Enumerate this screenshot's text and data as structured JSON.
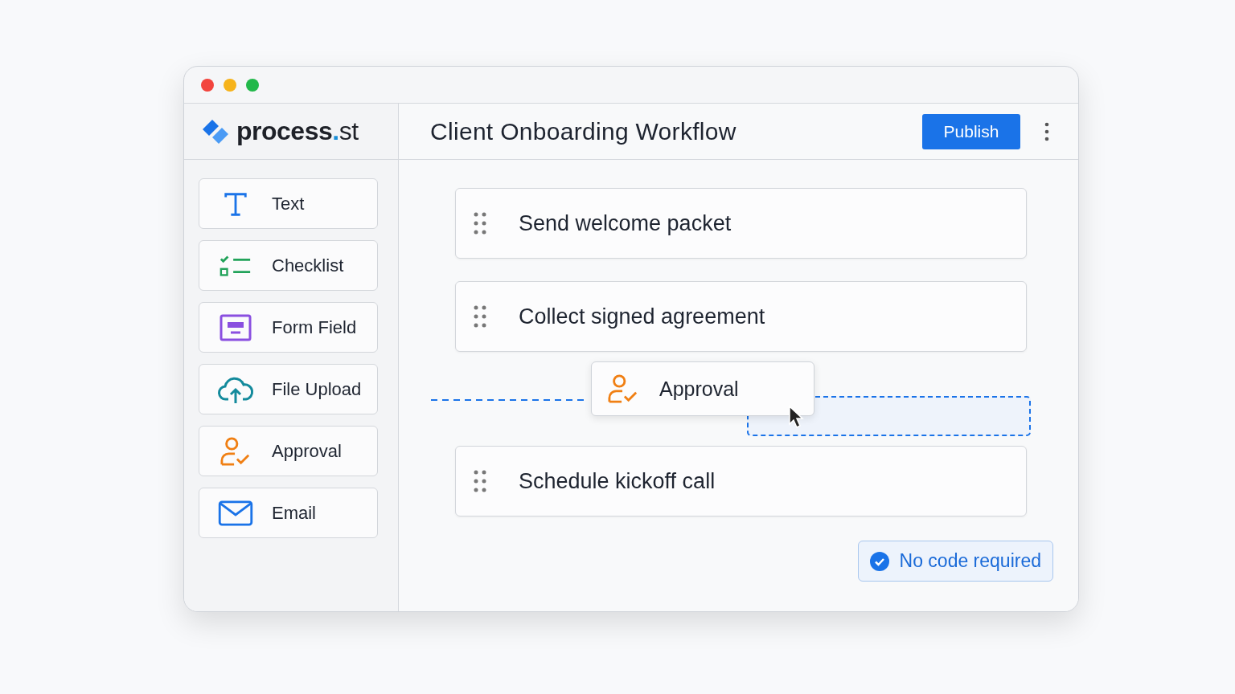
{
  "logo": {
    "name": "process",
    "separator": ".",
    "suffix": "st"
  },
  "palette": [
    {
      "label": "Text",
      "kind": "text"
    },
    {
      "label": "Checklist",
      "kind": "checklist"
    },
    {
      "label": "Form Field",
      "kind": "form"
    },
    {
      "label": "File Upload",
      "kind": "upload"
    },
    {
      "label": "Approval",
      "kind": "approval"
    },
    {
      "label": "Email",
      "kind": "email"
    }
  ],
  "header": {
    "title": "Client Onboarding Workflow",
    "publish": "Publish"
  },
  "steps": [
    {
      "kind": "step",
      "label": "Send welcome packet"
    },
    {
      "kind": "step",
      "label": "Collect signed agreement"
    },
    {
      "kind": "drop_slot",
      "dragged": {
        "label": "Approval",
        "kind": "approval"
      }
    },
    {
      "kind": "step",
      "label": "Schedule kickoff call"
    }
  ],
  "badge": {
    "label": "No code required"
  }
}
